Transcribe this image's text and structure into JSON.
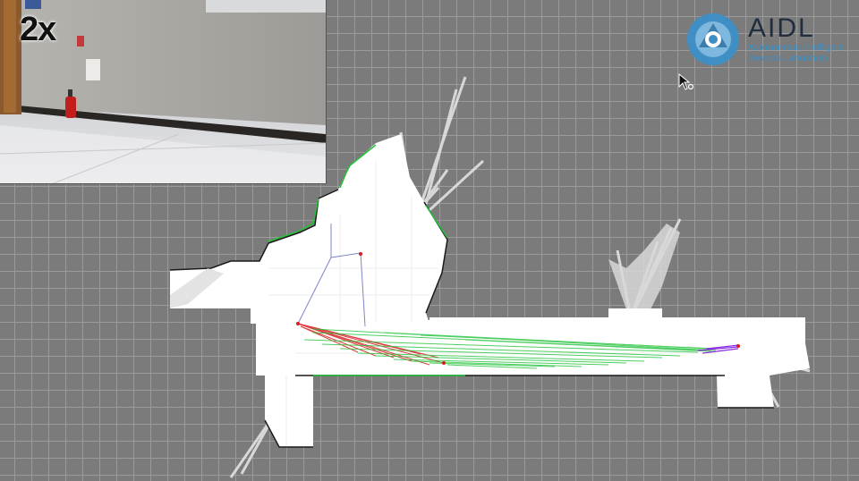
{
  "overlay": {
    "playback_speed": "2x"
  },
  "logo": {
    "name": "AIDL",
    "subtitle_line1": "Autonomous Intelligent",
    "subtitle_line2": "Devices Laboratory",
    "colors": {
      "ring": "#3f8fc4",
      "name": "#1f2d3d"
    }
  },
  "map": {
    "background": "#7b7b7b",
    "free_space": "#ffffff",
    "path_colors": {
      "green": "#22c23a",
      "red": "#d81c1c",
      "purple": "#8a2be2",
      "blue": "#7d86c8"
    }
  },
  "icons": [
    "mouse-cursor-icon",
    "aidl-logo-icon"
  ]
}
